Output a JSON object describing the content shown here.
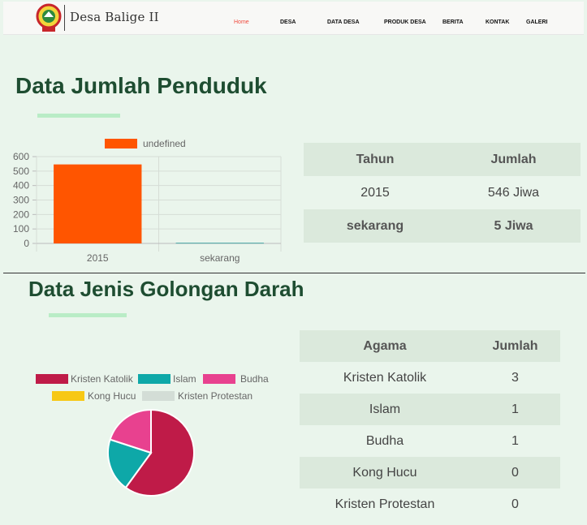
{
  "nav": {
    "brand": "Desa Balige II",
    "items": [
      {
        "label": "Home",
        "active": true
      },
      {
        "label": "DESA"
      },
      {
        "label": "DATA DESA"
      },
      {
        "label": "PRODUK DESA"
      },
      {
        "label": "BERITA"
      },
      {
        "label": "KONTAK"
      },
      {
        "label": "GALERI"
      }
    ]
  },
  "population": {
    "title": "Data Jumlah Penduduk",
    "table": {
      "headers": [
        "Tahun",
        "Jumlah"
      ],
      "rows": [
        [
          "2015",
          "546 Jiwa"
        ],
        [
          "sekarang",
          "5 Jiwa"
        ]
      ]
    }
  },
  "blood": {
    "title": "Data Jenis Golongan Darah",
    "table": {
      "headers": [
        "Agama",
        "Jumlah"
      ],
      "rows": [
        [
          "Kristen Katolik",
          "3"
        ],
        [
          "Islam",
          "1"
        ],
        [
          "Budha",
          "1"
        ],
        [
          "Kong Hucu",
          "0"
        ],
        [
          "Kristen Protestan",
          "0"
        ]
      ]
    }
  },
  "chart_data": [
    {
      "type": "bar",
      "categories": [
        "2015",
        "sekarang"
      ],
      "series": [
        {
          "name": "undefined",
          "values": [
            546,
            5
          ]
        }
      ],
      "ylim": [
        0,
        600
      ],
      "yticks": [
        0,
        100,
        200,
        300,
        400,
        500,
        600
      ],
      "grid": true,
      "legend": "top",
      "colors": {
        "bar1": "#ff5500",
        "bar2": "#49a5a7"
      }
    },
    {
      "type": "pie",
      "labels": [
        "Kristen Katolik",
        "Islam",
        "Budha",
        "Kong Hucu",
        "Kristen Protestan"
      ],
      "values": [
        3,
        1,
        1,
        0,
        0
      ],
      "colors": [
        "#bf1b48",
        "#0ea8a8",
        "#e8418f",
        "#f7c815",
        "#d3ddd6"
      ],
      "legend": "top"
    }
  ]
}
